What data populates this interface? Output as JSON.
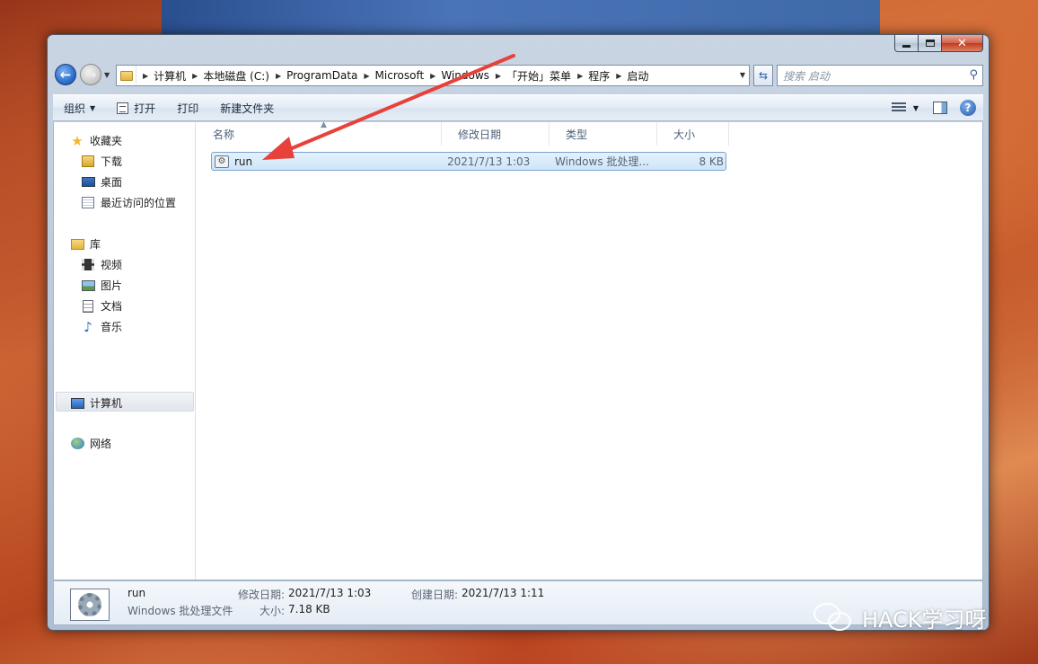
{
  "window": {
    "buttons": {
      "minimize": "minimize",
      "maximize": "maximize",
      "close": "✕"
    }
  },
  "address": {
    "crumbs": [
      "计算机",
      "本地磁盘 (C:)",
      "ProgramData",
      "Microsoft",
      "Windows",
      "「开始」菜单",
      "程序",
      "启动"
    ]
  },
  "search": {
    "placeholder": "搜索 启动"
  },
  "toolbar": {
    "organize": "组织",
    "open": "打开",
    "print": "打印",
    "new_folder": "新建文件夹"
  },
  "nav": {
    "favorites": "收藏夹",
    "downloads": "下载",
    "desktop": "桌面",
    "recent": "最近访问的位置",
    "libraries": "库",
    "videos": "视频",
    "pictures": "图片",
    "documents": "文档",
    "music": "音乐",
    "computer": "计算机",
    "network": "网络"
  },
  "columns": {
    "name": "名称",
    "modified": "修改日期",
    "type": "类型",
    "size": "大小"
  },
  "files": [
    {
      "name": "run",
      "modified": "2021/7/13 1:03",
      "type": "Windows 批处理...",
      "size": "8 KB"
    }
  ],
  "details": {
    "name": "run",
    "type": "Windows 批处理文件",
    "modified_label": "修改日期:",
    "modified": "2021/7/13 1:03",
    "created_label": "创建日期:",
    "created": "2021/7/13 1:11",
    "size_label": "大小:",
    "size": "7.18 KB"
  },
  "annotation": {
    "color": "#e8413a"
  },
  "watermark": {
    "text": "HACK学习呀"
  }
}
